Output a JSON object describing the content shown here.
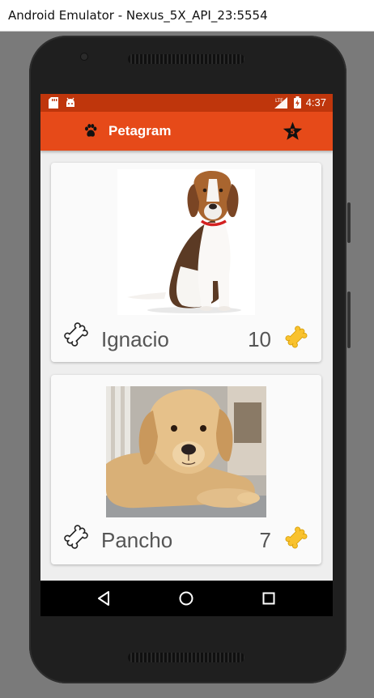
{
  "window": {
    "title": "Android Emulator - Nexus_5X_API_23:5554"
  },
  "status_bar": {
    "time": "4:37",
    "network": "LTE"
  },
  "app_bar": {
    "title": "Petagram"
  },
  "pets": [
    {
      "name": "Ignacio",
      "likes": "10"
    },
    {
      "name": "Pancho",
      "likes": "7"
    }
  ],
  "colors": {
    "status_bar": "#bf360c",
    "app_bar": "#e64a19",
    "like_bone": "#f9c22e",
    "card": "#fafafa"
  },
  "icons": {
    "app_logo": "paw-icon",
    "favorites": "star-icon",
    "rate": "bone-outline-icon",
    "likes": "bone-yellow-icon"
  }
}
